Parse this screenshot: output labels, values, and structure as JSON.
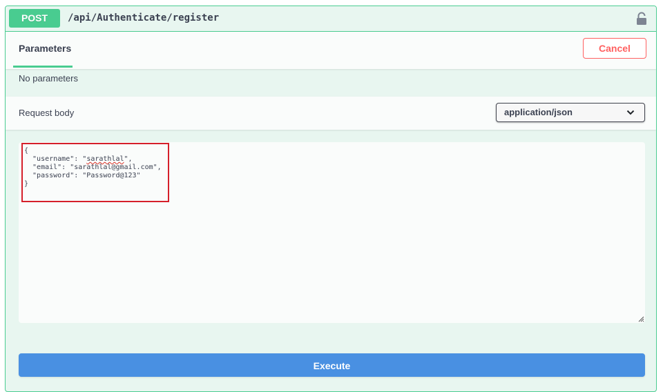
{
  "operation": {
    "method": "POST",
    "path": "/api/Authenticate/register",
    "lock_icon": "lock-icon",
    "method_color": "#49cc90"
  },
  "tabs": {
    "parameters_label": "Parameters",
    "cancel_label": "Cancel"
  },
  "parameters": {
    "empty_text": "No parameters"
  },
  "request_body": {
    "title": "Request body",
    "content_type": "application/json",
    "code_lines": [
      "{",
      "  \"username\": \"sarathlal\",",
      "  \"email\": \"sarathlal@gmail.com\",",
      "  \"password\": \"Password@123\"",
      "}"
    ]
  },
  "actions": {
    "execute_label": "Execute",
    "execute_color": "#4990e2",
    "cancel_color": "#ff6060"
  },
  "highlight_color": "#d51f2a"
}
